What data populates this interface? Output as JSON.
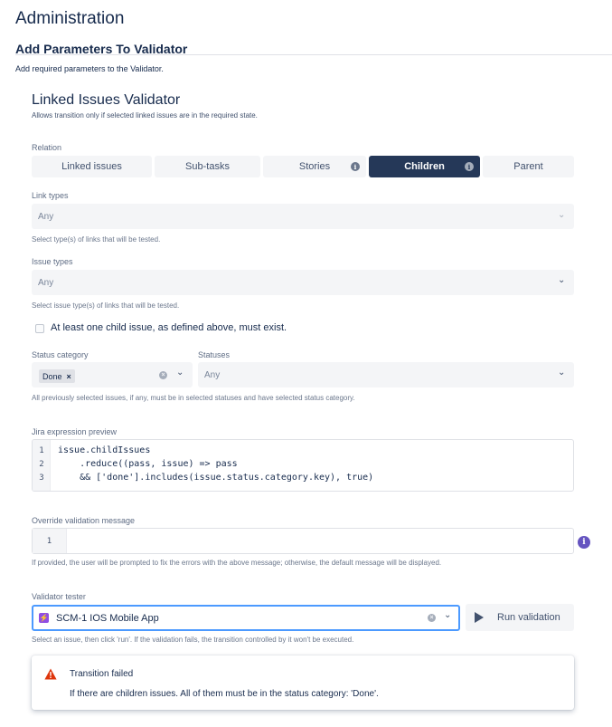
{
  "header": {
    "title": "Administration",
    "section_title": "Add Parameters To Validator",
    "section_desc": "Add required parameters to the Validator."
  },
  "validator": {
    "title": "Linked Issues Validator",
    "subtitle": "Allows transition only if selected linked issues are in the required state."
  },
  "relation": {
    "label": "Relation",
    "options": [
      "Linked issues",
      "Sub-tasks",
      "Stories",
      "Children",
      "Parent"
    ],
    "selected": "Children"
  },
  "link_types": {
    "label": "Link types",
    "value": "Any",
    "help": "Select type(s) of links that will be tested."
  },
  "issue_types": {
    "label": "Issue types",
    "value": "Any",
    "help": "Select issue type(s) of links that will be tested."
  },
  "child_required": {
    "label": "At least one child issue, as defined above, must exist.",
    "checked": false
  },
  "status_category": {
    "label": "Status category",
    "tags": [
      "Done"
    ]
  },
  "statuses": {
    "label": "Statuses",
    "value": "Any",
    "help": "All previously selected issues, if any, must be in selected statuses and have selected status category."
  },
  "expression_preview": {
    "label": "Jira expression preview",
    "line_numbers": [
      "1",
      "2",
      "3"
    ],
    "lines": [
      "issue.childIssues",
      "    .reduce((pass, issue) => pass",
      "    && ['done'].includes(issue.status.category.key), true)"
    ]
  },
  "override_message": {
    "label": "Override validation message",
    "line_number": "1",
    "value": "",
    "help": "If provided, the user will be prompted to fix the errors with the above message; otherwise, the default message will be displayed."
  },
  "tester": {
    "label": "Validator tester",
    "issue": "SCM-1 IOS Mobile App",
    "run_label": "Run validation",
    "help": "Select an issue, then click 'run'. If the validation fails, the transition controlled by it won't be executed."
  },
  "result": {
    "title": "Transition failed",
    "message": "If there are children issues. All of them must be in the status category: 'Done'."
  },
  "colors": {
    "active_segment": "#253858",
    "info_purple": "#6554c0",
    "focus_border": "#4c9aff",
    "error_red": "#de350b",
    "issue_icon": "#904ee2"
  }
}
